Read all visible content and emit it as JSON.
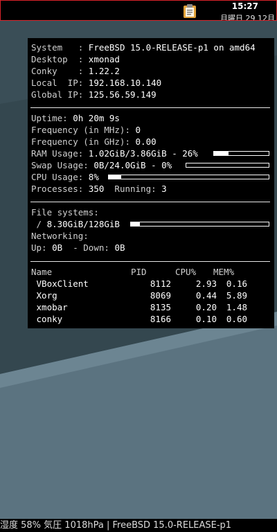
{
  "topbar": {
    "time": "15:27",
    "date": "月曜日 29 12月"
  },
  "conky": {
    "system": [
      {
        "label": "System   : ",
        "value": "FreeBSD 15.0-RELEASE-p1 on amd64"
      },
      {
        "label": "Desktop  : ",
        "value": "xmonad"
      },
      {
        "label": "Conky    : ",
        "value": "1.22.2"
      },
      {
        "label": "Local  IP: ",
        "value": "192.168.10.140"
      },
      {
        "label": "Global IP: ",
        "value": "125.56.59.149"
      }
    ],
    "uptime": {
      "label": "Uptime: ",
      "value": "0h 20m 9s"
    },
    "freq_mhz": {
      "label": "Frequency (in MHz): ",
      "value": "0"
    },
    "freq_ghz": {
      "label": "Frequency (in GHz): ",
      "value": "0.00"
    },
    "ram": {
      "label": "RAM Usage: ",
      "value": "1.02GiB/3.86GiB - 26%",
      "level": 0.26
    },
    "swap": {
      "label": "Swap Usage: ",
      "value": "0B/24.0GiB - 0%",
      "level": 0.0
    },
    "cpu": {
      "label": "CPU Usage: ",
      "value": "8%",
      "level": 0.08
    },
    "processes": {
      "label": "Processes: ",
      "value": "350",
      "running_label": "  Running: ",
      "running_value": "3"
    },
    "fs_title": "File systems:",
    "fs": {
      "label": " / ",
      "value": "8.30GiB/128GiB",
      "level": 0.065
    },
    "net_title": "Networking:",
    "net": {
      "up_label": "Up: ",
      "up_value": "0B",
      "down_label": "  - Down: ",
      "down_value": "0B"
    },
    "table": {
      "headers": {
        "name": "Name",
        "pid": "PID",
        "cpu": "CPU%",
        "mem": "MEM%"
      },
      "rows": [
        {
          "name": " VBoxClient",
          "pid": "8112",
          "cpu": "2.93",
          "mem": "0.16"
        },
        {
          "name": " Xorg",
          "pid": "8069",
          "cpu": "0.44",
          "mem": "5.89"
        },
        {
          "name": " xmobar",
          "pid": "8135",
          "cpu": "0.20",
          "mem": "1.48"
        },
        {
          "name": " conky",
          "pid": "8166",
          "cpu": "0.10",
          "mem": "0.60"
        }
      ]
    }
  },
  "statusbar": {
    "text": "湿度 58% 気圧 1018hPa | FreeBSD 15.0-RELEASE-p1"
  },
  "icons": {
    "topbar": "clipboard-icon"
  }
}
